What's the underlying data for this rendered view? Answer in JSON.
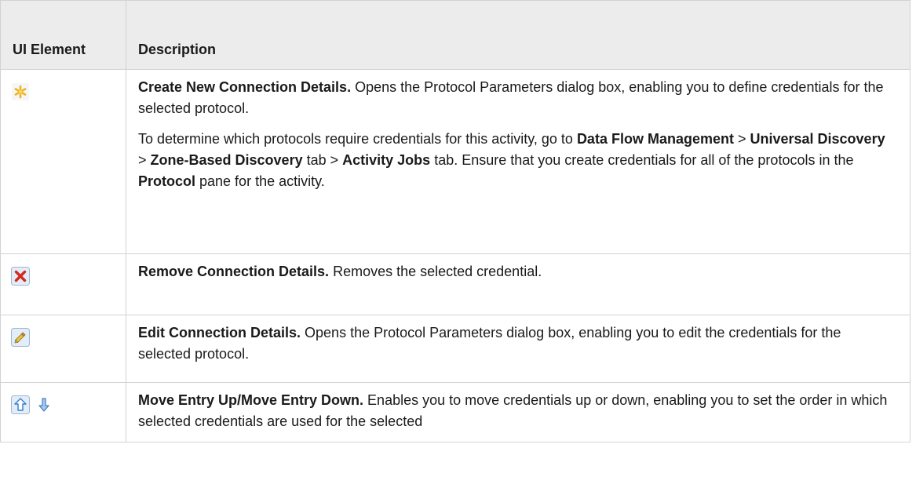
{
  "table": {
    "header": {
      "col1": "UI Element",
      "col2": "Description"
    },
    "rows": [
      {
        "icons": [
          "asterisk-new-icon"
        ],
        "para1": {
          "title": "Create New Connection Details.",
          "text": " Opens the Protocol Parameters dialog box, enabling you to define credentials for the selected protocol."
        },
        "para2": {
          "t1": "To determine which protocols require credentials for this activity, go to ",
          "b1": "Data Flow Management",
          "t2": " > ",
          "b2": "Universal Discovery",
          "t3": " > ",
          "b3": "Zone-Based Discovery",
          "t4": " tab > ",
          "b4": "Activity Jobs",
          "t5": " tab. Ensure that you create credentials for all of the protocols in the ",
          "b5": "Protocol",
          "t6": " pane for the activity."
        }
      },
      {
        "icons": [
          "red-x-delete-icon"
        ],
        "title": "Remove Connection Details.",
        "text": " Removes the selected credential."
      },
      {
        "icons": [
          "pencil-edit-icon"
        ],
        "title": "Edit Connection Details.",
        "text": " Opens the Protocol Parameters dialog box, enabling you to edit the credentials for the selected protocol."
      },
      {
        "icons": [
          "arrow-up-icon",
          "arrow-down-icon"
        ],
        "title": "Move Entry Up/Move Entry Down.",
        "text": " Enables you to move credentials up or down, enabling you to set the order in which selected credentials are used for the selected"
      }
    ]
  }
}
